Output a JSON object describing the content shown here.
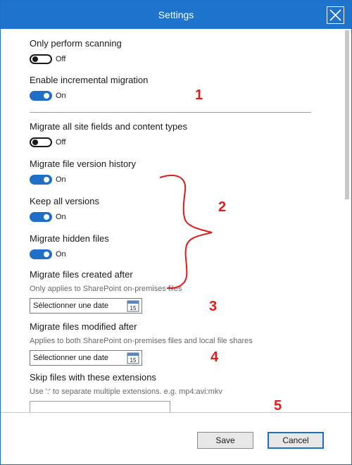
{
  "window": {
    "title": "Settings"
  },
  "settings": [
    {
      "label": "Only perform scanning",
      "state": "Off"
    },
    {
      "label": "Enable incremental migration",
      "state": "On"
    },
    {
      "label": "Migrate all site fields and content types",
      "state": "Off"
    },
    {
      "label": "Migrate file version history",
      "state": "On"
    },
    {
      "label": "Keep all versions",
      "state": "On"
    },
    {
      "label": "Migrate hidden files",
      "state": "On"
    }
  ],
  "date_filters": [
    {
      "label": "Migrate files created after",
      "hint": "Only applies to SharePoint on-premises files",
      "placeholder": "Sélectionner une date",
      "cal_day": "15"
    },
    {
      "label": "Migrate files modified after",
      "hint": "Applies to both SharePoint on-premises files and local file shares",
      "placeholder": "Sélectionner une date",
      "cal_day": "15"
    }
  ],
  "extensions": {
    "label": "Skip files with these extensions",
    "hint": "Use ':' to separate multiple extensions. e.g. mp4:avi:mkv",
    "value": ""
  },
  "annotations": [
    "1",
    "2",
    "3",
    "4",
    "5"
  ],
  "footer": {
    "save_label": "Save",
    "cancel_label": "Cancel"
  },
  "colors": {
    "accent": "#1e74cc",
    "annotation": "#e11a1a"
  }
}
